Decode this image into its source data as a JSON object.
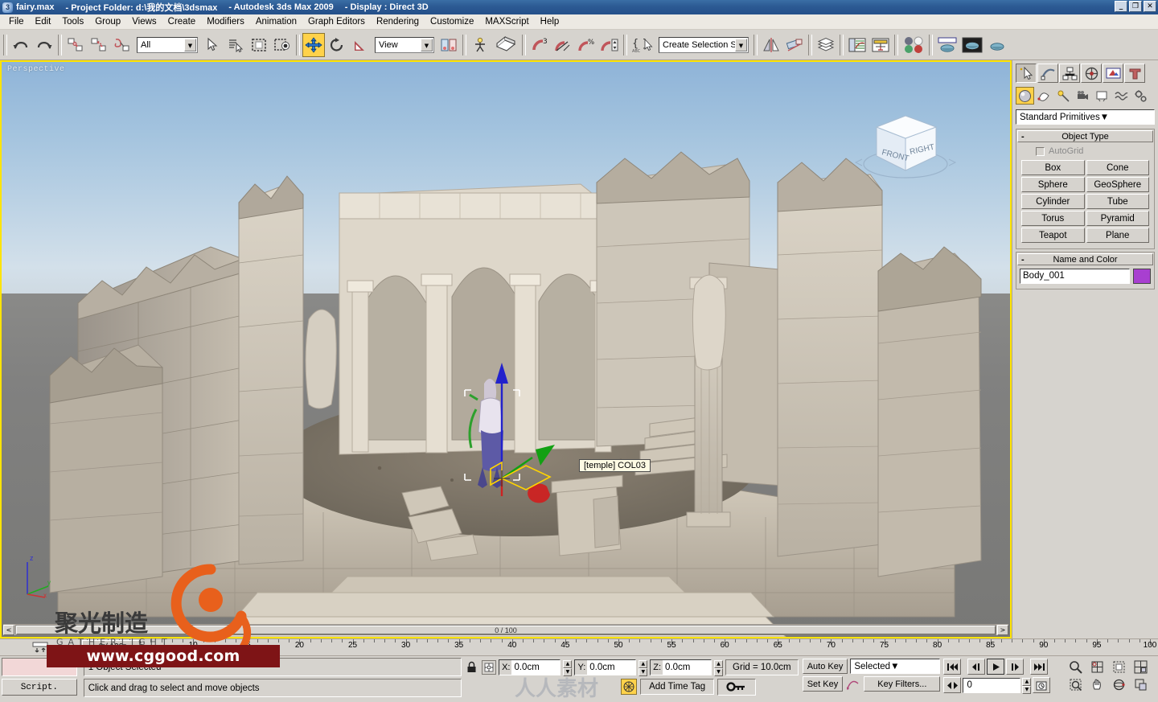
{
  "window": {
    "app_icon": "max-logo-icon",
    "file_name": "fairy.max",
    "project_folder": "- Project Folder: d:\\我的文档\\3dsmax",
    "app_name": "- Autodesk 3ds Max  2009",
    "display_mode": "- Display : Direct 3D",
    "minimize": "_",
    "restore": "❐",
    "close": "✕"
  },
  "menu": {
    "items": [
      "File",
      "Edit",
      "Tools",
      "Group",
      "Views",
      "Create",
      "Modifiers",
      "Animation",
      "Graph Editors",
      "Rendering",
      "Customize",
      "MAXScript",
      "Help"
    ]
  },
  "toolbar": {
    "undo": "undo-icon",
    "redo": "redo-icon",
    "select_link": "select-and-link-icon",
    "unlink": "unlink-selection-icon",
    "bind_space_warp": "bind-to-space-warp-icon",
    "selection_filter_value": "All",
    "select_object": "select-object-icon",
    "select_by_name": "select-by-name-icon",
    "select_region": "rectangular-selection-region-icon",
    "window_crossing": "window-crossing-icon",
    "select_move": "select-and-move-icon",
    "select_rotate": "select-and-rotate-icon",
    "select_scale": "select-and-scale-icon",
    "ref_coord_value": "View",
    "use_center": "use-pivot-point-center-icon",
    "select_manipulate": "select-and-manipulate-icon",
    "snap_toggle": "snaps-toggle-icon",
    "angle_snap": "angle-snap-toggle-icon",
    "percent_snap": "percent-snap-toggle-icon",
    "spinner_snap": "spinner-snap-toggle-icon",
    "named_selection": "edit-named-selection-sets-icon",
    "selection_set_value": "Create Selection Set",
    "mirror": "mirror-icon",
    "align": "align-icon",
    "layer_manager": "layer-manager-icon",
    "curve_editor": "curve-editor-icon",
    "schematic_view": "schematic-view-icon",
    "material_editor": "material-editor-icon",
    "render_setup": "render-setup-icon",
    "render_frame_window": "rendered-frame-window-icon",
    "render_production": "render-production-icon"
  },
  "viewport": {
    "label": "Perspective",
    "tooltip": "[temple] COL03",
    "viewcube": {
      "front": "FRONT",
      "right": "RIGHT"
    },
    "axis": {
      "z": "z",
      "x": "x",
      "y": "y"
    },
    "scroll_range": "0 / 100",
    "scroll_left": "<",
    "scroll_right": ">",
    "colors": {
      "active_border": "#ffe400",
      "sky_top": "#8fb4d8",
      "sky_bottom": "#d3e0ea",
      "ground": "#828280",
      "stone_light": "#cdc6ba",
      "stone_dark": "#8e8a83",
      "gizmo_z": "#1b1bd0",
      "gizmo_x": "#d01b1b",
      "gizmo_y": "#12a012",
      "selection": "#ffffff"
    }
  },
  "command_panel": {
    "tabs": [
      {
        "name": "create-tab",
        "icon": "arrow-star-icon",
        "selected": true
      },
      {
        "name": "modify-tab",
        "icon": "modify-curve-icon",
        "selected": false
      },
      {
        "name": "hierarchy-tab",
        "icon": "hierarchy-icon",
        "selected": false
      },
      {
        "name": "motion-tab",
        "icon": "motion-wheel-icon",
        "selected": false
      },
      {
        "name": "display-tab",
        "icon": "display-monitor-icon",
        "selected": false
      },
      {
        "name": "utilities-tab",
        "icon": "hammer-icon",
        "selected": false
      }
    ],
    "category_buttons": [
      {
        "name": "geometry-category",
        "icon": "sphere-icon",
        "selected": true
      },
      {
        "name": "shapes-category",
        "icon": "shapes-icon",
        "selected": false
      },
      {
        "name": "lights-category",
        "icon": "light-icon",
        "selected": false
      },
      {
        "name": "cameras-category",
        "icon": "camera-icon",
        "selected": false
      },
      {
        "name": "helpers-category",
        "icon": "helper-icon",
        "selected": false
      },
      {
        "name": "space-warps-category",
        "icon": "wave-icon",
        "selected": false
      },
      {
        "name": "systems-category",
        "icon": "gears-icon",
        "selected": false
      }
    ],
    "subcategory": "Standard Primitives",
    "object_type": {
      "title": "Object Type",
      "collapse": "-",
      "autogrid_label": "AutoGrid",
      "autogrid_checked": false,
      "buttons": [
        "Box",
        "Cone",
        "Sphere",
        "GeoSphere",
        "Cylinder",
        "Tube",
        "Torus",
        "Pyramid",
        "Teapot",
        "Plane"
      ]
    },
    "name_and_color": {
      "title": "Name and Color",
      "collapse": "-",
      "object_name": "Body_001",
      "color_swatch": "#a83fd0"
    }
  },
  "timeline": {
    "ticks_major": [
      0,
      5,
      10,
      15,
      20,
      25,
      30,
      35,
      40,
      45,
      50,
      55,
      60,
      65,
      70,
      75,
      80,
      85,
      90,
      95,
      100
    ],
    "current_frame_label": "0",
    "slider_label": "0 / 100",
    "track_view_icon": "open-mini-curve-editor-icon"
  },
  "status": {
    "mini_listener": "",
    "script_button": "Script.",
    "selection_status": "1 Object Selected",
    "prompt": "Click and drag to select and move objects",
    "lock_icon": "selection-lock-toggle-icon",
    "absolute_mode_icon": "absolute-relative-transform-toggle-icon",
    "coords": [
      {
        "axis": "X:",
        "value": "0.0cm"
      },
      {
        "axis": "Y:",
        "value": "0.0cm"
      },
      {
        "axis": "Z:",
        "value": "0.0cm"
      }
    ],
    "grid_label": "Grid = 10.0cm",
    "add_time_tag": "Add Time Tag",
    "time_tag_icon": "time-tag-icon",
    "key_mode_icon": "key-mode-toggle-icon"
  },
  "animation": {
    "auto_key": "Auto Key",
    "set_key": "Set Key",
    "key_filters": "Key Filters...",
    "selection_level": "Selected",
    "set_key_curve_icon": "set-key-curve-icon",
    "playback": {
      "go_to_start": "go-to-start-icon",
      "previous_frame": "previous-frame-icon",
      "play": "play-animation-icon",
      "next_frame": "next-frame-icon",
      "go_to_end": "go-to-end-icon",
      "key_mode": "key-mode-toggle-icon",
      "current_frame": "0",
      "time_configuration": "time-configuration-icon"
    },
    "nav": [
      "zoom-icon",
      "zoom-all-icon",
      "zoom-extents-icon",
      "zoom-extents-all-icon",
      "field-of-view-icon",
      "region-zoom-icon",
      "pan-view-icon",
      "orbit-icon",
      "maximize-viewport-toggle-icon"
    ]
  },
  "watermark": {
    "url": "www.cggood.com",
    "brand_cn": "聚光制造",
    "brand_en": "GATHERLIGHT",
    "center_mark": "人人素材",
    "bar_color": "#7e1416"
  }
}
